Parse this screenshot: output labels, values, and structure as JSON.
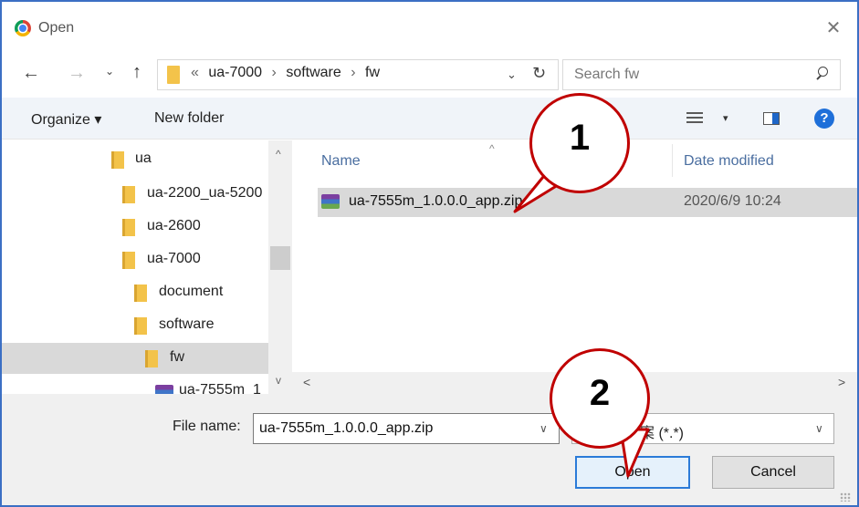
{
  "window": {
    "title": "Open",
    "close_glyph": "✕"
  },
  "nav": {
    "back_glyph": "←",
    "forward_glyph": "→",
    "recent_glyph": "⌄",
    "up_glyph": "↑",
    "crumbs": [
      "«",
      "ua-7000",
      "›",
      "software",
      "›",
      "fw"
    ],
    "dropdown_glyph": "⌄",
    "refresh_glyph": "↻"
  },
  "search": {
    "placeholder": "Search fw"
  },
  "toolbar": {
    "organize_label": "Organize ▾",
    "new_folder_label": "New folder",
    "view_dd": "▾",
    "help_label": "?"
  },
  "tree": {
    "items": [
      {
        "label": "ua",
        "type": "folder"
      },
      {
        "label": "ua-2200_ua-5200",
        "type": "folder"
      },
      {
        "label": "ua-2600",
        "type": "folder"
      },
      {
        "label": "ua-7000",
        "type": "folder"
      },
      {
        "label": "document",
        "type": "folder"
      },
      {
        "label": "software",
        "type": "folder"
      },
      {
        "label": "fw",
        "type": "folder",
        "selected": true
      },
      {
        "label": "ua-7555m_1",
        "type": "zip"
      }
    ],
    "scroll_up": "^",
    "scroll_down": "v"
  },
  "filelist": {
    "columns": {
      "name": "Name",
      "date": "Date modified",
      "sort_glyph": "^"
    },
    "rows": [
      {
        "name": "ua-7555m_1.0.0.0_app.zip",
        "date": "2020/6/9 10:24",
        "selected": true
      }
    ],
    "hscroll_left": "<",
    "hscroll_right": ">"
  },
  "bottom": {
    "file_name_label": "File name:",
    "file_name_value": "ua-7555m_1.0.0.0_app.zip",
    "file_name_dd": "∨",
    "file_type_value": "案 (*.*)",
    "file_type_dd": "∨",
    "open_label": "Open",
    "cancel_label": "Cancel"
  },
  "callouts": {
    "one": "1",
    "two": "2"
  },
  "colors": {
    "accent": "#2b7bd8",
    "callout_border": "#c00000",
    "folder": "#f3c34a",
    "selection": "#d9d9d9"
  }
}
